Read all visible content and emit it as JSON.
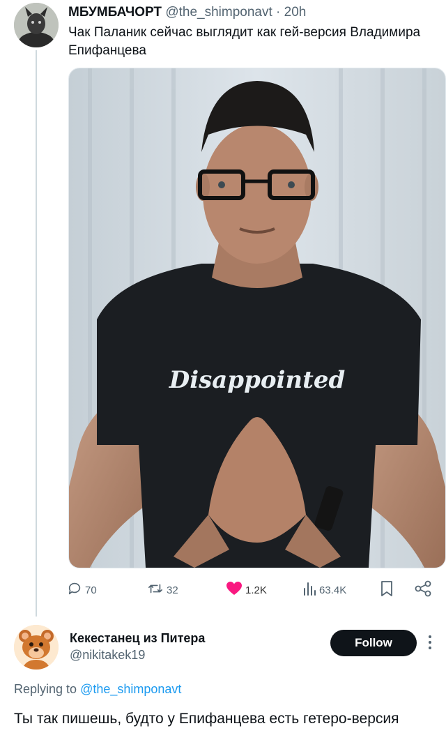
{
  "tweet": {
    "display_name": "МБУМБАЧОРТ",
    "handle": "@the_shimponavt",
    "separator": "·",
    "time": "20h",
    "text": "Чак Паланик сейчас выглядит как гей-версия Владимира Епифанцева",
    "image_shirt_text": "Disappointed",
    "actions": {
      "replies": "70",
      "retweets": "32",
      "likes": "1.2K",
      "views": "63.4K",
      "reply_icon": "comment-icon",
      "retweet_icon": "retweet-icon",
      "like_icon": "heart-icon",
      "views_icon": "views-bar-chart-icon",
      "bookmark_icon": "bookmark-icon",
      "share_icon": "share-icon",
      "like_color": "#f91880"
    }
  },
  "reply": {
    "display_name": "Кекестанец из Питера",
    "handle": "@nikitakek19",
    "follow_label": "Follow",
    "replying_prefix": "Replying to",
    "replying_to": "@the_shimponavt",
    "text": "Ты так пишешь, будто у Епифанцева есть гетеро-версия"
  },
  "colors": {
    "text_primary": "#0f1419",
    "text_secondary": "#536471",
    "link": "#1d9bf0",
    "follow_bg": "#0f1419"
  }
}
